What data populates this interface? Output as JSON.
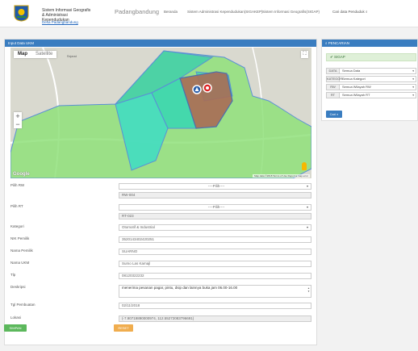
{
  "header": {
    "app_title": "Sistem Informasi Geografis & Administrasi Kependudukan",
    "desa_link": "Desa Padangbandung",
    "nav_home": "Padangbandung",
    "nav_items": [
      "Beranda",
      "Sistem Administrasi Kependudukan(SIGAKEP)",
      "Sistem Informasi Geografis(SIGAP)"
    ],
    "search_label": "Cari data Penduduk"
  },
  "input_panel": {
    "title": "Input Data UKM",
    "map": {
      "type_map": "Map",
      "type_satellite": "Satellite",
      "zoom_in": "+",
      "zoom_out": "−",
      "google": "Google",
      "footer": "Map data ©2018   Terms of Use   Report a map error"
    },
    "fields": [
      {
        "label": "Pilih RW",
        "value": "----Pilih----",
        "sub_value": "RW-004"
      },
      {
        "label": "Pilih RT",
        "value": "----Pilih----",
        "sub_value": "RT-023"
      },
      {
        "label": "Kategori",
        "value": "Otomotif & Industrial"
      },
      {
        "label": "NIK Pemilik",
        "value": "3520143402420251"
      },
      {
        "label": "Nama Pemilik",
        "value": "SUARNO"
      },
      {
        "label": "Nama UKM",
        "value": "Sumo Las Kamajl"
      },
      {
        "label": "Tlp",
        "value": "08120322232"
      },
      {
        "label": "Deskripsi",
        "value": "menerima pesanan pagar, pintu, dsip dan lainnya buka jam 06.00-16.00"
      },
      {
        "label": "Tgl Pembuatan",
        "value": "02/11/2018"
      },
      {
        "label": "Lokasi",
        "value": "(-7.90719890000974, 112.55272083796691)"
      }
    ],
    "btn_save": "SIMPAN",
    "btn_reset": "RESET"
  },
  "search_panel": {
    "title": "PENCARIAN",
    "sigap": "SIGAP",
    "filters": [
      {
        "label": "DATA",
        "value": "Semua Data"
      },
      {
        "label": "KATEGORI",
        "value": "Semua Kategori"
      },
      {
        "label": "RW",
        "value": "Semua Wilayah RW"
      },
      {
        "label": "RT",
        "value": "Semua Wilayah RT"
      }
    ],
    "btn_search": "Cari"
  },
  "colors": {
    "primary": "#3a7dc0",
    "success": "#5cb85c",
    "warning": "#f0ad4e"
  }
}
